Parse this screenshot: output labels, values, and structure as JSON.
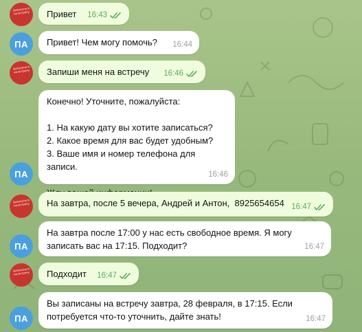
{
  "avatars": {
    "user_initials": "ПА",
    "contact_tiny_text": "Записаться на встречу"
  },
  "messages": [
    {
      "side": "out",
      "text": "Привет",
      "time": "16:43",
      "read": true
    },
    {
      "side": "in",
      "text": "Привет! Чем могу помочь?",
      "time": "16:44"
    },
    {
      "side": "out",
      "text": "Запиши меня на встречу",
      "time": "16:46",
      "read": true
    },
    {
      "side": "in",
      "text": "Конечно! Уточните, пожалуйста:\n\n1. На какую дату вы хотите записаться?\n2. Какое время для вас будет удобным?\n3. Ваше имя и номер телефона для записи.\n\nЖду вашей информации!",
      "time": "16:46"
    },
    {
      "side": "out",
      "text": "На завтра, после 5 вечера, Андрей и Антон,  8925654654",
      "time": "16:47",
      "read": true
    },
    {
      "side": "in",
      "text": "На завтра после 17:00 у нас есть свободное время. Я могу\nзаписать вас на 17:15. Подходит?",
      "time": "16:47"
    },
    {
      "side": "out",
      "text": "Подходит",
      "time": "16:47",
      "read": true
    },
    {
      "side": "in",
      "text": "Вы записаны на встречу завтра, 28 февраля, в 17:15. Если\nпотребуется что-то уточнить, дайте знать!",
      "time": "16:47"
    }
  ]
}
